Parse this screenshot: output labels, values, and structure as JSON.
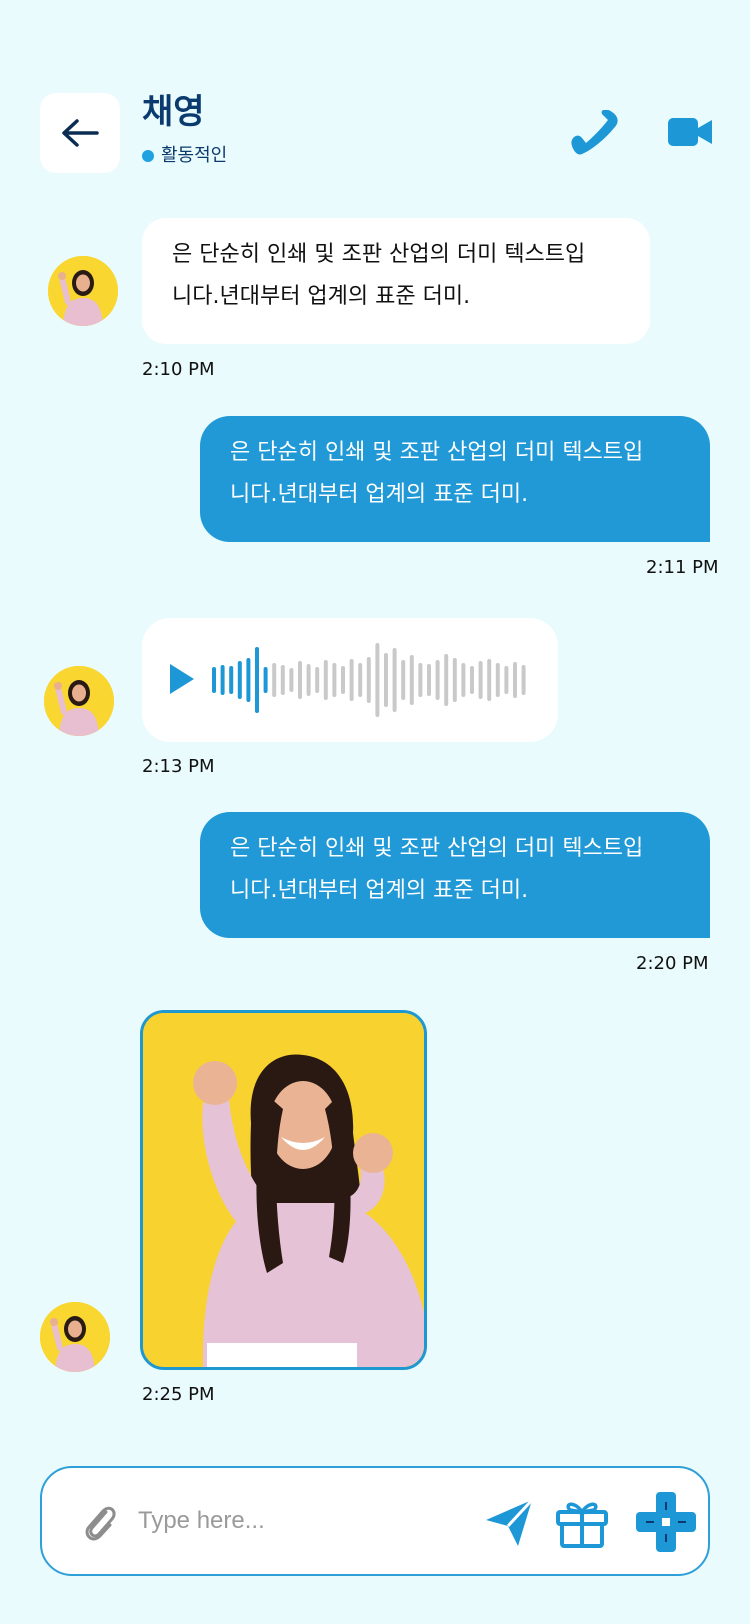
{
  "header": {
    "contact_name": "채영",
    "status": "활동적인"
  },
  "messages": [
    {
      "direction": "in",
      "type": "text",
      "lines": [
        "은 단순히 인쇄 및 조판 산업의 더미 텍스트입",
        "니다.년대부터 업계의 표준 더미."
      ],
      "time": "2:10 PM"
    },
    {
      "direction": "out",
      "type": "text",
      "lines": [
        "은 단순히 인쇄 및 조판 산업의 더미 텍스트입",
        "니다.년대부터 업계의 표준 더미."
      ],
      "time": "2:11 PM"
    },
    {
      "direction": "in",
      "type": "voice",
      "time": "2:13 PM"
    },
    {
      "direction": "out",
      "type": "text",
      "lines": [
        "은 단순히 인쇄 및 조판 산업의 더미 텍스트입",
        "니다.년대부터 업계의 표준 더미."
      ],
      "time": "2:20 PM"
    },
    {
      "direction": "in",
      "type": "image",
      "time": "2:25 PM"
    }
  ],
  "composer": {
    "placeholder": "Type here..."
  },
  "colors": {
    "background": "#e9fbfd",
    "accent": "#2099d6",
    "status_online": "#1fa2e0",
    "avatar_bg": "#f9d630"
  },
  "icons": [
    "back-arrow-icon",
    "phone-icon",
    "video-camera-icon",
    "play-icon",
    "paperclip-icon",
    "send-icon",
    "gift-icon",
    "gamepad-icon"
  ]
}
